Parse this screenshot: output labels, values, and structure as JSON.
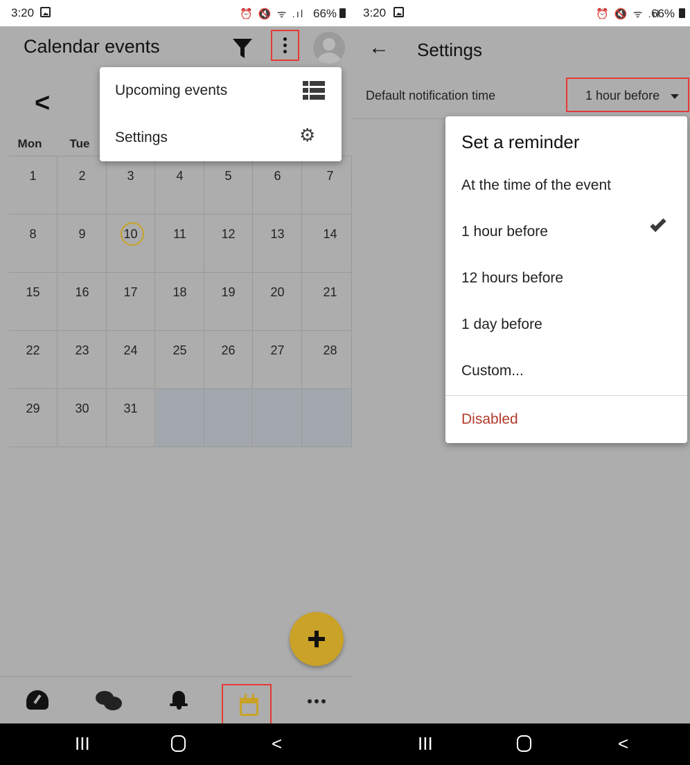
{
  "status_bar": {
    "time": "3:20",
    "battery": "66%",
    "sys_icons": "⏰ 🔇 ᯤ .ıl"
  },
  "left": {
    "app_title": "Calendar events",
    "menu": [
      {
        "label": "Upcoming events",
        "icon": "list-icon"
      },
      {
        "label": "Settings",
        "icon": "cogs-icon"
      }
    ],
    "calendar": {
      "weekdays_visible": [
        "Mon",
        "Tue"
      ],
      "days": [
        "1",
        "2",
        "3",
        "4",
        "5",
        "6",
        "7",
        "8",
        "9",
        "10",
        "11",
        "12",
        "13",
        "14",
        "15",
        "16",
        "17",
        "18",
        "19",
        "20",
        "21",
        "22",
        "23",
        "24",
        "25",
        "26",
        "27",
        "28",
        "29",
        "30",
        "31"
      ],
      "today": "10"
    },
    "bottom_nav": [
      "dashboard-icon",
      "chat-icon",
      "bell-icon",
      "calendar-icon",
      "more-icon"
    ],
    "accent_color": "#c9a227"
  },
  "right": {
    "title": "Settings",
    "setting_label": "Default notification time",
    "setting_value": "1 hour before",
    "popup": {
      "title": "Set a reminder",
      "options": [
        "At the time of the event",
        "1 hour before",
        "12 hours before",
        "1 day before",
        "Custom..."
      ],
      "selected": "1 hour before",
      "disabled_label": "Disabled"
    }
  },
  "system_nav": {
    "recents": "III",
    "back": "<"
  }
}
